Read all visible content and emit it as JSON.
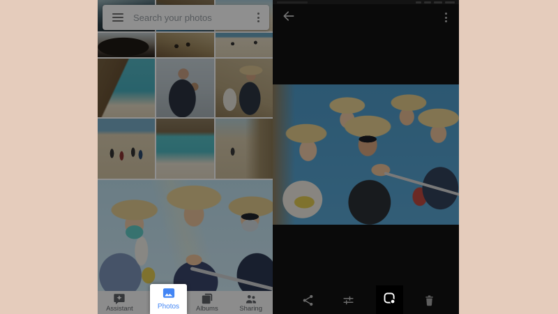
{
  "colors": {
    "page_background": "#e5ccbc",
    "accent_blue": "#4285f4",
    "highlight_white": "#ffffff",
    "lens_highlight_bg": "#000000",
    "right_screen_bg": "#121212"
  },
  "left_screen": {
    "search": {
      "placeholder": "Search your photos",
      "menu_icon": "hamburger-icon",
      "more_icon": "more-vert-icon"
    },
    "nav": {
      "items": [
        {
          "label": "Assistant",
          "icon": "assistant-bubble-star-icon",
          "active": false
        },
        {
          "label": "Photos",
          "icon": "photos-mountain-icon",
          "active": true
        },
        {
          "label": "Albums",
          "icon": "albums-book-icon",
          "active": false
        },
        {
          "label": "Sharing",
          "icon": "sharing-people-icon",
          "active": false
        }
      ]
    },
    "grid": {
      "rows": 4,
      "columns": 3,
      "content": "beach and group-selfie travel photo thumbnails"
    }
  },
  "right_screen": {
    "top_bar": {
      "back_icon": "arrow-left-icon",
      "more_icon": "more-vert-icon"
    },
    "photo": {
      "content": "group selfie of six people wearing straw hats under blue sky"
    },
    "toolbar": {
      "icons": [
        {
          "name": "share-icon",
          "highlighted": false
        },
        {
          "name": "edit-icon",
          "highlighted": false
        },
        {
          "name": "lens-icon",
          "highlighted": true
        },
        {
          "name": "delete-icon",
          "highlighted": false
        }
      ]
    }
  }
}
